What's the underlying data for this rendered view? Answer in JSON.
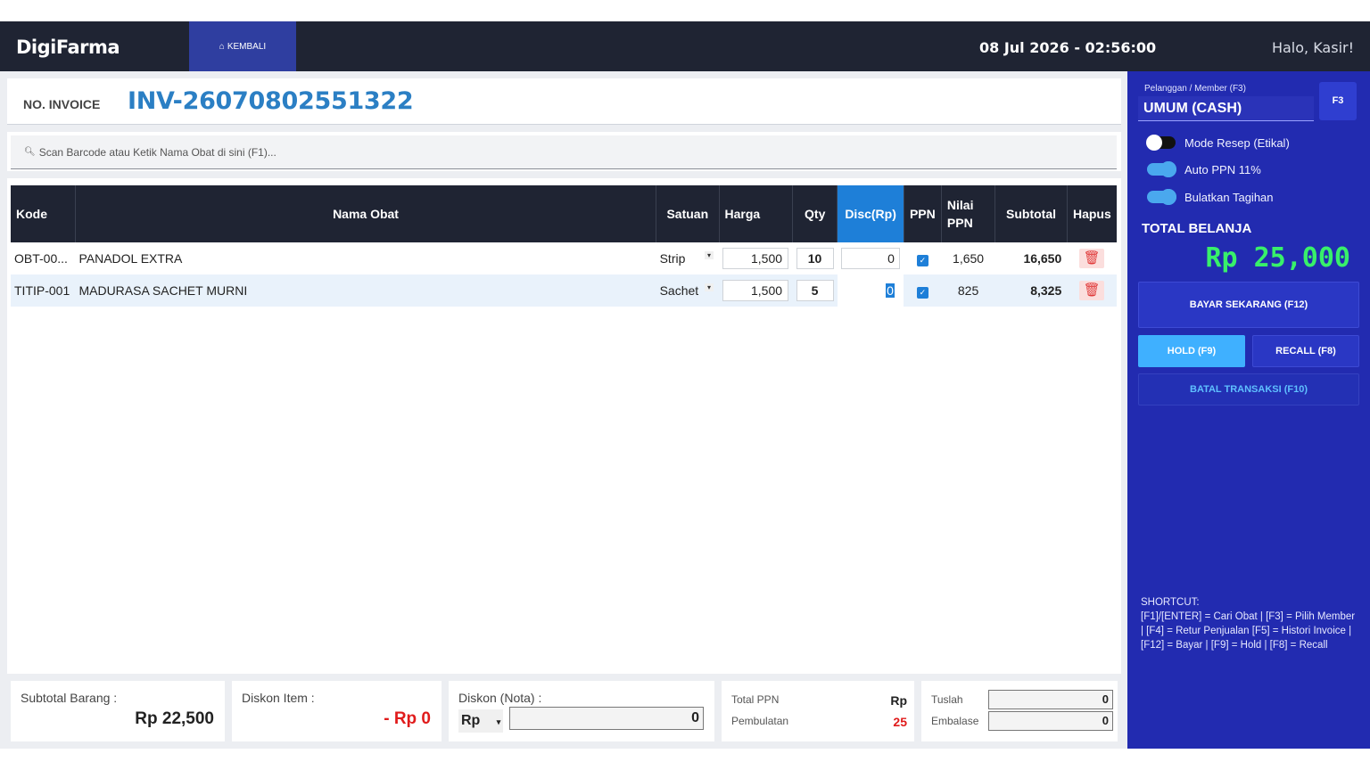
{
  "header": {
    "brand": "DigiFarma",
    "back_label": "KEMBALI",
    "datetime": "08 Jul 2026 - 02:56:00",
    "greeting": "Halo, Kasir!"
  },
  "invoice": {
    "label": "NO. INVOICE",
    "number": "INV-26070802551322"
  },
  "search": {
    "placeholder": "Scan Barcode atau Ketik Nama Obat di sini (F1)..."
  },
  "table": {
    "columns": [
      "Kode",
      "Nama Obat",
      "Satuan",
      "Harga",
      "Qty",
      "Disc(Rp)",
      "PPN",
      "Nilai PPN",
      "Subtotal",
      "Hapus"
    ],
    "rows": [
      {
        "kode": "OBT-00...",
        "nama": "PANADOL EXTRA",
        "satuan": "Strip",
        "harga": "1,500",
        "qty": "10",
        "disc": "0",
        "ppn_checked": true,
        "nilai_ppn": "1,650",
        "subtotal": "16,650"
      },
      {
        "kode": "TITIP-001",
        "nama": "MADURASA SACHET MURNI",
        "satuan": "Sachet",
        "harga": "1,500",
        "qty": "5",
        "disc": "0",
        "ppn_checked": true,
        "nilai_ppn": "825",
        "subtotal": "8,325"
      }
    ]
  },
  "footer": {
    "subtotal_label": "Subtotal Barang :",
    "subtotal_value": "Rp 22,500",
    "diskon_item_label": "Diskon Item :",
    "diskon_item_value": "- Rp 0",
    "diskon_nota_label": "Diskon (Nota) :",
    "diskon_nota_type": "Rp",
    "diskon_nota_value": "0",
    "total_ppn_label": "Total PPN",
    "total_ppn_value": "Rp",
    "pembulatan_label": "Pembulatan",
    "pembulatan_value": "25",
    "tuslah_label": "Tuslah",
    "tuslah_value": "0",
    "embalase_label": "Embalase",
    "embalase_value": "0"
  },
  "sidebar": {
    "member_label": "Pelanggan / Member (F3)",
    "member_value": "UMUM (CASH)",
    "f3_label": "F3",
    "toggles": [
      {
        "label": "Mode Resep (Etikal)",
        "on": false
      },
      {
        "label": "Auto PPN 11%",
        "on": true
      },
      {
        "label": "Bulatkan Tagihan",
        "on": true
      }
    ],
    "total_label": "TOTAL BELANJA",
    "total_value": "Rp 25,000",
    "pay_label": "BAYAR SEKARANG (F12)",
    "hold_label": "HOLD (F9)",
    "recall_label": "RECALL (F8)",
    "batal_label": "BATAL TRANSAKSI (F10)",
    "shortcut_title": "SHORTCUT:",
    "shortcut_text": "[F1]/[ENTER] = Cari Obat | [F3] = Pilih Member | [F4] = Retur Penjualan [F5] = Histori Invoice | [F12] = Bayar | [F9] = Hold | [F8] = Recall"
  },
  "colors": {
    "topbar": "#1f2433",
    "accent_blue": "#1e7fd8",
    "sidebar": "#222bb0",
    "total_green": "#38f06a",
    "danger": "#e03b3b"
  }
}
